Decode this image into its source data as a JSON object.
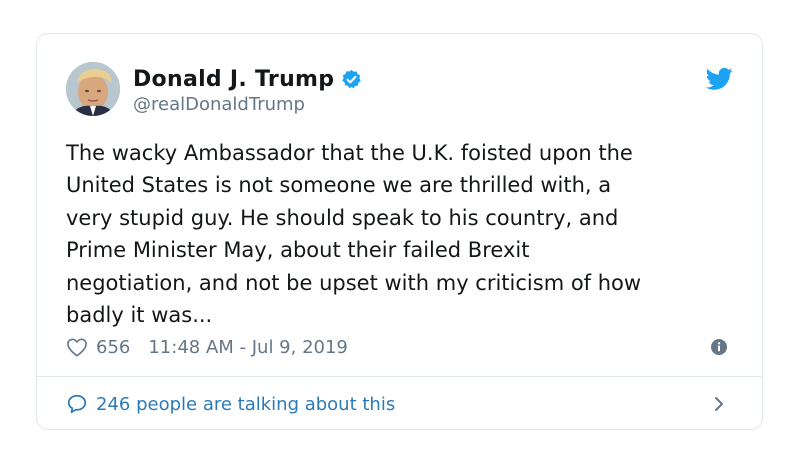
{
  "user": {
    "display_name": "Donald J. Trump",
    "handle": "@realDonaldTrump",
    "verified": true
  },
  "tweet": {
    "text": "The wacky Ambassador that the U.K. foisted upon the\nUnited States is not someone we are thrilled with, a\nvery stupid guy. He should speak to his country, and\nPrime Minister May, about their failed Brexit\nnegotiation, and not be upset with my criticism of how\nbadly it was...",
    "likes": "656",
    "timestamp": "11:48 AM - Jul 9, 2019"
  },
  "footer": {
    "talking_label": "246 people are talking about this"
  },
  "icons": {
    "brand": "twitter-bird-icon",
    "verified": "verified-badge-icon",
    "like": "heart-icon",
    "info": "info-icon",
    "reply": "speech-bubble-icon",
    "more": "chevron-right-icon"
  },
  "colors": {
    "accent": "#1da1f2",
    "link": "#2b7bb9",
    "secondary_text": "#657786",
    "border": "#e1e8ed"
  }
}
